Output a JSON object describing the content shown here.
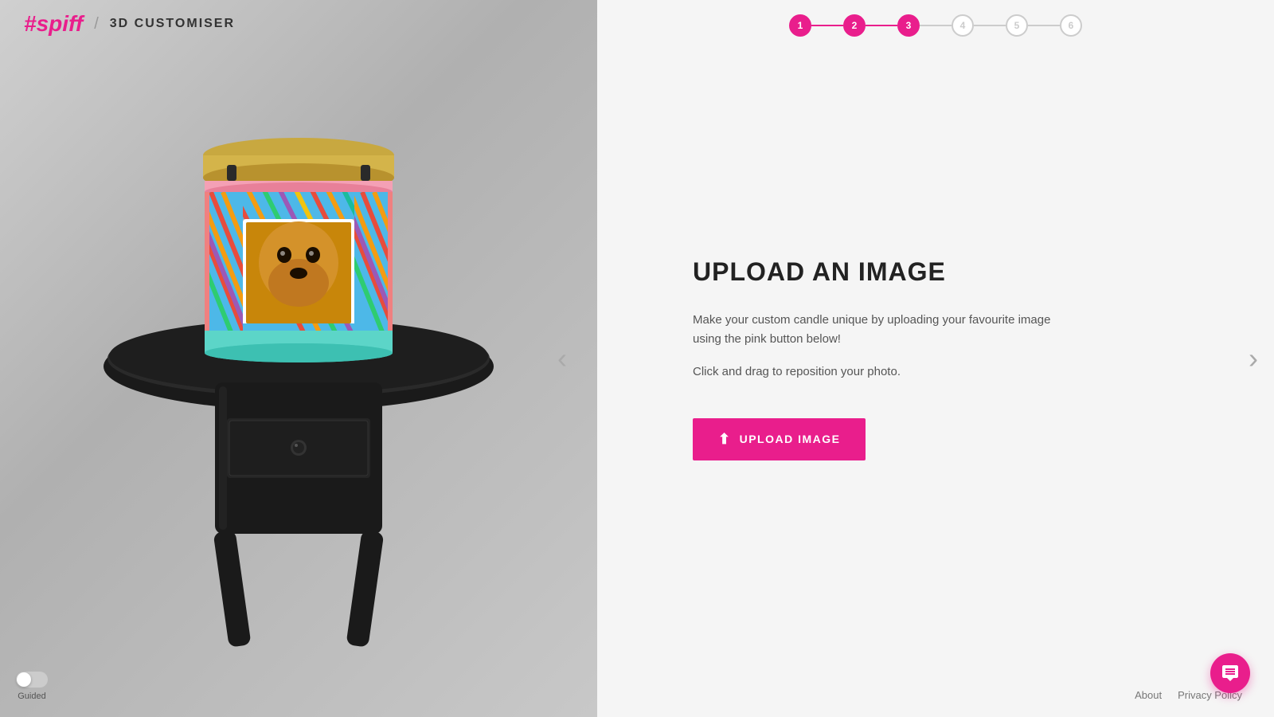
{
  "header": {
    "logo_hash": "#",
    "logo_name": "spiff",
    "logo_divider": "/",
    "logo_subtitle": "3D CUSTOMISER"
  },
  "stepper": {
    "steps": [
      {
        "number": "1",
        "state": "completed"
      },
      {
        "number": "2",
        "state": "completed"
      },
      {
        "number": "3",
        "state": "active"
      },
      {
        "number": "4",
        "state": "inactive"
      },
      {
        "number": "5",
        "state": "inactive"
      },
      {
        "number": "6",
        "state": "inactive"
      }
    ]
  },
  "viewer": {
    "alt": "3D candle product viewer"
  },
  "controls": {
    "left_arrow": "‹",
    "right_arrow": "›"
  },
  "content": {
    "title": "UPLOAD AN IMAGE",
    "description_line1": "Make your custom candle unique by uploading your favourite image",
    "description_line2": "using the pink button below!",
    "hint": "Click and drag to reposition your photo.",
    "upload_button": "UPLOAD IMAGE"
  },
  "guided": {
    "label": "Guided"
  },
  "footer": {
    "about": "About",
    "privacy": "Privacy Policy"
  },
  "colors": {
    "brand_pink": "#e91e8c",
    "step_active": "#e91e8c",
    "step_inactive": "#ccc",
    "text_dark": "#222",
    "text_mid": "#555",
    "text_light": "#aaa"
  }
}
